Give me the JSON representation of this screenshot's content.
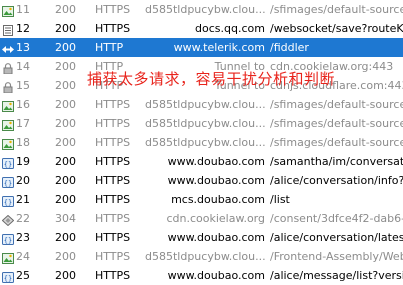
{
  "sessions": [
    {
      "id": "11",
      "result": "200",
      "protocol": "HTTPS",
      "host": "d585tldpucybw.clou...",
      "url": "/sfimages/default-source/",
      "icon": "image-icon",
      "style": "gray"
    },
    {
      "id": "12",
      "result": "200",
      "protocol": "HTTPS",
      "host": "docs.qq.com",
      "url": "/websocket/save?routeKe",
      "icon": "document-icon",
      "style": "normal"
    },
    {
      "id": "13",
      "result": "200",
      "protocol": "HTTP",
      "host": "www.telerik.com",
      "url": "/fiddler",
      "icon": "arrows-icon",
      "style": "selected"
    },
    {
      "id": "14",
      "result": "200",
      "protocol": "HTTP",
      "host": "Tunnel to",
      "url": "cdn.cookielaw.org:443",
      "icon": "lock-icon",
      "style": "gray"
    },
    {
      "id": "15",
      "result": "200",
      "protocol": "HTTP",
      "host": "Tunnel to",
      "url": "cdnjs.cloudflare.com:443",
      "icon": "lock-icon",
      "style": "gray"
    },
    {
      "id": "16",
      "result": "200",
      "protocol": "HTTPS",
      "host": "d585tldpucybw.clou...",
      "url": "/sfimages/default-source/",
      "icon": "image-icon",
      "style": "gray"
    },
    {
      "id": "17",
      "result": "200",
      "protocol": "HTTPS",
      "host": "d585tldpucybw.clou...",
      "url": "/sfimages/default-source/",
      "icon": "image-icon",
      "style": "gray"
    },
    {
      "id": "18",
      "result": "200",
      "protocol": "HTTPS",
      "host": "d585tldpucybw.clou...",
      "url": "/sfimages/default-source/",
      "icon": "image-icon",
      "style": "gray"
    },
    {
      "id": "19",
      "result": "200",
      "protocol": "HTTPS",
      "host": "www.doubao.com",
      "url": "/samantha/im/conversatio",
      "icon": "json-icon",
      "style": "normal"
    },
    {
      "id": "20",
      "result": "200",
      "protocol": "HTTPS",
      "host": "www.doubao.com",
      "url": "/alice/conversation/info?v",
      "icon": "json-icon",
      "style": "normal"
    },
    {
      "id": "21",
      "result": "200",
      "protocol": "HTTPS",
      "host": "mcs.doubao.com",
      "url": "/list",
      "icon": "json-icon",
      "style": "normal"
    },
    {
      "id": "22",
      "result": "304",
      "protocol": "HTTPS",
      "host": "cdn.cookielaw.org",
      "url": "/consent/3dfce4f2-dab6-",
      "icon": "diamond-icon",
      "style": "gray"
    },
    {
      "id": "23",
      "result": "200",
      "protocol": "HTTPS",
      "host": "www.doubao.com",
      "url": "/alice/conversation/latest",
      "icon": "json-icon",
      "style": "normal"
    },
    {
      "id": "24",
      "result": "200",
      "protocol": "HTTPS",
      "host": "d585tldpucybw.clou...",
      "url": "/Frontend-Assembly/Web",
      "icon": "image-icon",
      "style": "gray"
    },
    {
      "id": "25",
      "result": "200",
      "protocol": "HTTPS",
      "host": "www.doubao.com",
      "url": "/alice/message/list?versio",
      "icon": "json-icon",
      "style": "normal"
    }
  ],
  "annotation": "捕获太多请求，容易干扰分析和判断"
}
